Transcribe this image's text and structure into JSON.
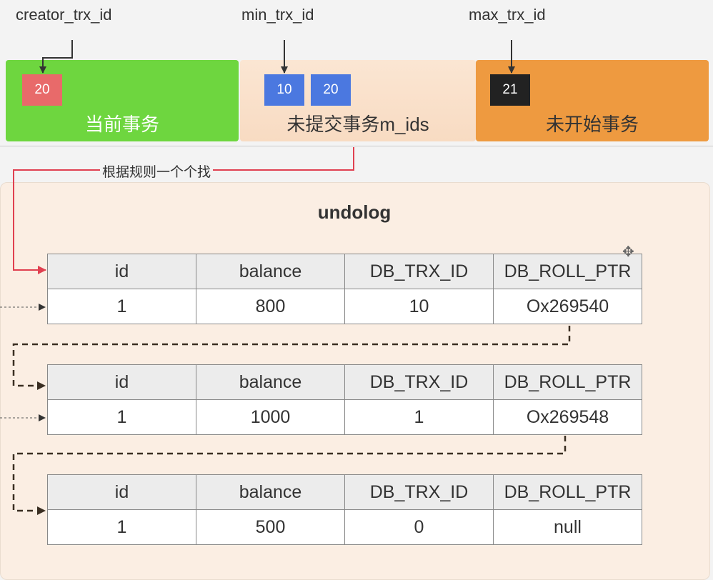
{
  "labels": {
    "creator": "creator_trx_id",
    "min": "min_trx_id",
    "max": "max_trx_id",
    "rule_note": "根据规则一个个找"
  },
  "zones": {
    "current": {
      "label": "当前事务",
      "chip": "20",
      "chip_color": "#e86a6a"
    },
    "uncommitted": {
      "label": "未提交事务m_ids",
      "chips": [
        "10",
        "20"
      ],
      "chip_color": "#4b78e0"
    },
    "not_started": {
      "label": "未开始事务",
      "chip": "21",
      "chip_color": "#222222"
    }
  },
  "colors": {
    "current_bg": "#6ed63f",
    "uncommitted_bg": "#f9e0c8",
    "not_started_bg": "#ee9a40",
    "arrow_red": "#e04050",
    "chain_dash": "#4a3a2a"
  },
  "undolog": {
    "title": "undolog",
    "headers": [
      "id",
      "balance",
      "DB_TRX_ID",
      "DB_ROLL_PTR"
    ],
    "records": [
      [
        "1",
        "800",
        "10",
        "Ox269540"
      ],
      [
        "1",
        "1000",
        "1",
        "Ox269548"
      ],
      [
        "1",
        "500",
        "0",
        "null"
      ]
    ]
  },
  "icons": {
    "move": "move-cursor-icon"
  }
}
